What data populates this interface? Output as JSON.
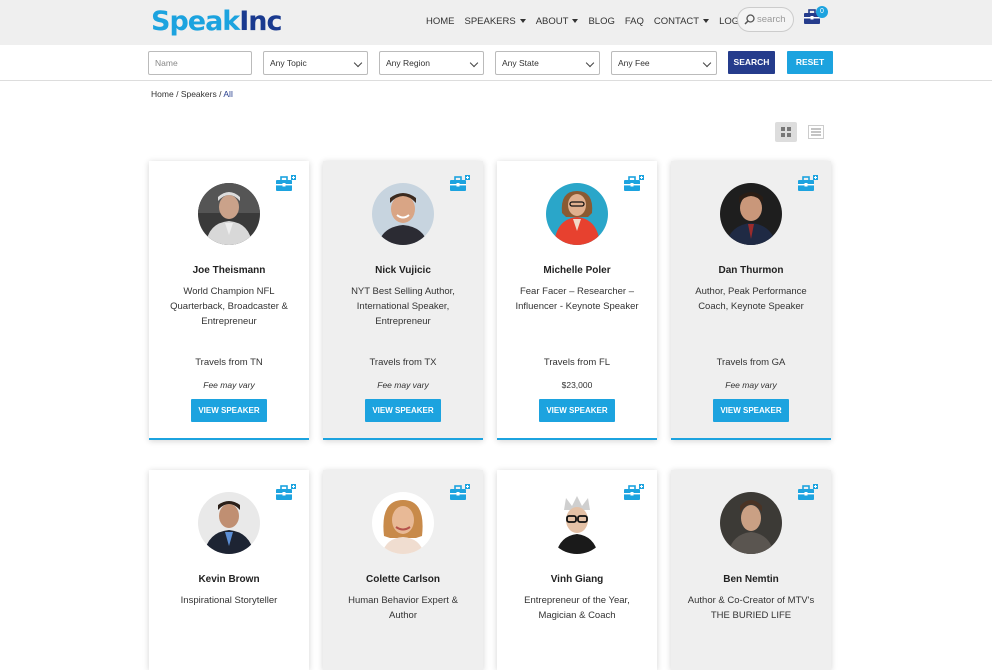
{
  "brand": {
    "logo_part1": "Speak",
    "logo_part2": "Inc"
  },
  "nav": {
    "home": "HOME",
    "speakers": "SPEAKERS",
    "about": "ABOUT",
    "blog": "BLOG",
    "faq": "FAQ",
    "contact": "CONTACT",
    "login": "LOGIN",
    "search_placeholder": "search",
    "cart_count": "0"
  },
  "filters": {
    "name_placeholder": "Name",
    "topic": "Any Topic",
    "region": "Any Region",
    "state": "Any State",
    "fee": "Any Fee",
    "search_label": "SEARCH",
    "reset_label": "RESET"
  },
  "breadcrumb": {
    "home": "Home",
    "speakers": "Speakers",
    "current": "All",
    "sep": "/"
  },
  "speakers": [
    {
      "name": "Joe Theismann",
      "title": "World Champion NFL Quarterback, Broadcaster & Entrepreneur",
      "travel": "Travels from TN",
      "fee": "Fee may vary",
      "button": "VIEW SPEAKER"
    },
    {
      "name": "Nick Vujicic",
      "title": "NYT Best Selling Author, International Speaker, Entrepreneur",
      "travel": "Travels from TX",
      "fee": "Fee may vary",
      "button": "VIEW SPEAKER"
    },
    {
      "name": "Michelle Poler",
      "title": "Fear Facer – Researcher – Influencer - Keynote Speaker",
      "travel": "Travels from FL",
      "fee": "$23,000",
      "button": "VIEW SPEAKER"
    },
    {
      "name": "Dan Thurmon",
      "title": "Author, Peak Performance Coach, Keynote Speaker",
      "travel": "Travels from GA",
      "fee": "Fee may vary",
      "button": "VIEW SPEAKER"
    },
    {
      "name": "Kevin Brown",
      "title": "Inspirational Storyteller"
    },
    {
      "name": "Colette Carlson",
      "title": "Human Behavior Expert & Author"
    },
    {
      "name": "Vinh Giang",
      "title": "Entrepreneur of the Year, Magician & Coach"
    },
    {
      "name": "Ben Nemtin",
      "title": "Author & Co-Creator of MTV's THE BURIED LIFE"
    }
  ],
  "colors": {
    "accent": "#1ca3df",
    "navy": "#253c8c"
  }
}
